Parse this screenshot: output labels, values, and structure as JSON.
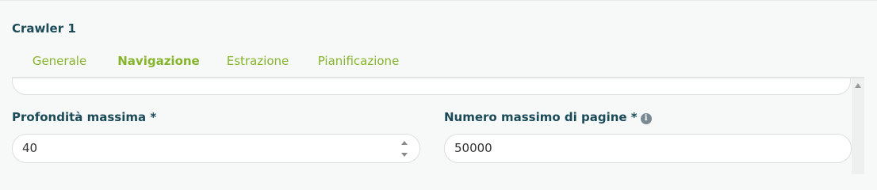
{
  "header": {
    "title": "Crawler 1"
  },
  "tabs": [
    {
      "label": "Generale",
      "active": false
    },
    {
      "label": "Navigazione",
      "active": true
    },
    {
      "label": "Estrazione",
      "active": false
    },
    {
      "label": "Pianificazione",
      "active": false
    }
  ],
  "form": {
    "max_depth": {
      "label": "Profondità massima *",
      "value": "40"
    },
    "max_pages": {
      "label": "Numero massimo di pagine *",
      "value": "50000",
      "info_icon": "info-icon"
    }
  },
  "colors": {
    "accent": "#86b52c",
    "label": "#1b4b58"
  }
}
